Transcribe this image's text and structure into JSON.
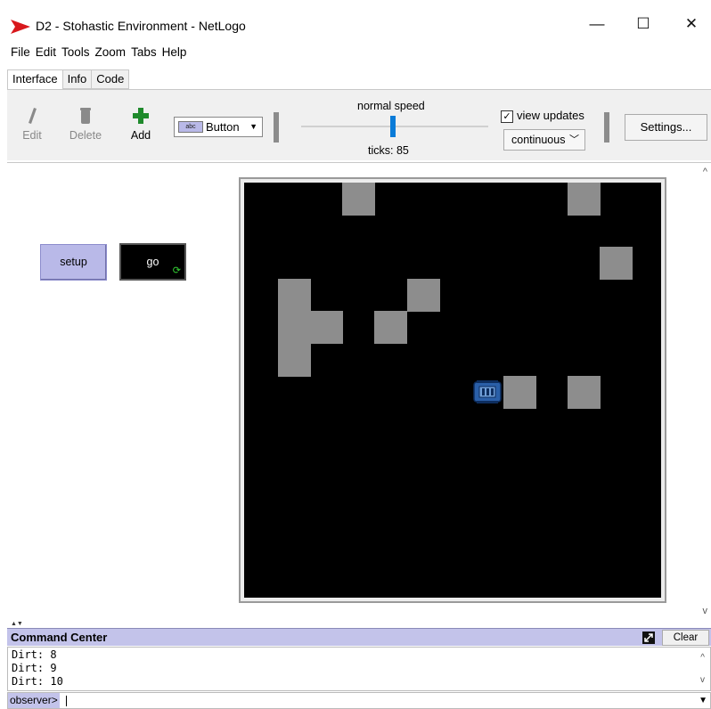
{
  "window": {
    "title": "D2 - Stohastic Environment - NetLogo",
    "minimize": "—",
    "maximize": "☐",
    "close": "✕"
  },
  "menu": [
    "File",
    "Edit",
    "Tools",
    "Zoom",
    "Tabs",
    "Help"
  ],
  "tabs": [
    "Interface",
    "Info",
    "Code"
  ],
  "toolbar": {
    "edit": "Edit",
    "delete": "Delete",
    "add": "Add",
    "widget_type": "Button",
    "widget_icon_text": "abc",
    "speed_label": "normal speed",
    "speed_value": 0.5,
    "ticks": "ticks: 85",
    "view_updates_checked": true,
    "view_updates": "view updates",
    "update_mode": "continuous",
    "settings": "Settings..."
  },
  "widgets": {
    "setup": "setup",
    "go": "go",
    "go_forever": true
  },
  "world": {
    "background": "#000000",
    "patch_color": "#8d8d8d",
    "grid_size": 13,
    "dirt_patches": [
      {
        "col": 3,
        "row": 0
      },
      {
        "col": 10,
        "row": 0
      },
      {
        "col": 11,
        "row": 2
      },
      {
        "col": 1,
        "row": 3
      },
      {
        "col": 5,
        "row": 3
      },
      {
        "col": 1,
        "row": 4
      },
      {
        "col": 2,
        "row": 4
      },
      {
        "col": 4,
        "row": 4
      },
      {
        "col": 1,
        "row": 5
      },
      {
        "col": 8,
        "row": 6
      },
      {
        "col": 10,
        "row": 6
      }
    ],
    "robot": {
      "col": 7,
      "row": 6,
      "color": "#2a5fa8"
    }
  },
  "command_center": {
    "title": "Command Center",
    "clear": "Clear",
    "output": [
      "Dirt: 8",
      "Dirt: 9",
      "Dirt: 10"
    ],
    "agent": "observer>",
    "input_value": ""
  }
}
